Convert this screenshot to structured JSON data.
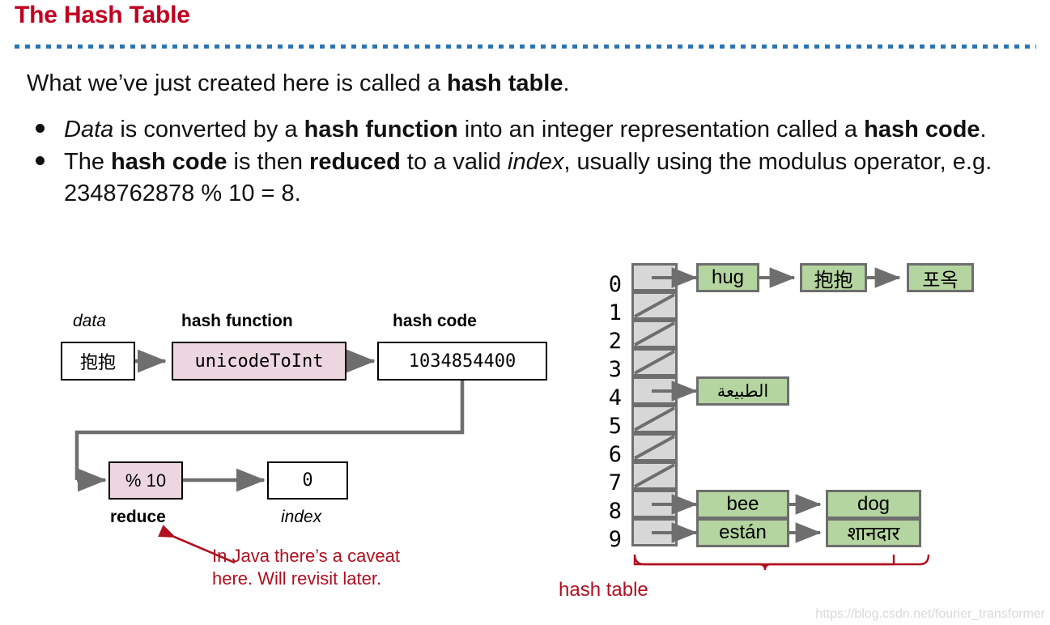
{
  "slide": {
    "title": "The Hash Table",
    "accent_color": "#c00020",
    "rule_color": "#2a74b5",
    "intro_prefix": "What we’ve just created here is called a ",
    "intro_bold": "hash table",
    "intro_suffix": ".",
    "bullets": [
      {
        "parts": [
          {
            "text": "Data",
            "style": "italic"
          },
          {
            "text": " is converted by a ",
            "style": "normal"
          },
          {
            "text": "hash function",
            "style": "bold"
          },
          {
            "text": " into an integer representation called a ",
            "style": "normal"
          },
          {
            "text": "hash code",
            "style": "bold"
          },
          {
            "text": ".",
            "style": "normal"
          }
        ]
      },
      {
        "parts": [
          {
            "text": "The ",
            "style": "normal"
          },
          {
            "text": "hash code",
            "style": "bold"
          },
          {
            "text": " is then ",
            "style": "normal"
          },
          {
            "text": "reduced",
            "style": "bold"
          },
          {
            "text": " to a valid ",
            "style": "normal"
          },
          {
            "text": "index",
            "style": "italic"
          },
          {
            "text": ", usually using the modulus operator, e.g. 2348762878 % 10 = 8.",
            "style": "normal"
          }
        ]
      }
    ]
  },
  "flow": {
    "labels": {
      "data": "data",
      "hash_function": "hash function",
      "hash_code": "hash code",
      "reduce": "reduce",
      "index": "index"
    },
    "boxes": {
      "data_value": "抱抱",
      "function_value": "unicodeToInt",
      "hashcode_value": "1034854400",
      "modulus_value": "% 10",
      "index_value": "0"
    },
    "pink_color": "#ecd6df",
    "arrow_color": "#6e6e6e"
  },
  "annotation": {
    "text": "In Java there’s a caveat\nhere. Will revisit later.",
    "color": "#b01020"
  },
  "hash_table": {
    "label": "hash table",
    "label_color": "#b01020",
    "slot_fill": "#d7d7d7",
    "slot_border": "#6e6e6e",
    "node_fill": "#b4d4a0",
    "node_border": "#6e6e6e",
    "indices": [
      "0",
      "1",
      "2",
      "3",
      "4",
      "5",
      "6",
      "7",
      "8",
      "9"
    ],
    "buckets": [
      {
        "index": "0",
        "empty": false,
        "chain": [
          "hug",
          "抱抱",
          "포옥"
        ]
      },
      {
        "index": "1",
        "empty": true,
        "chain": []
      },
      {
        "index": "2",
        "empty": true,
        "chain": []
      },
      {
        "index": "3",
        "empty": true,
        "chain": []
      },
      {
        "index": "4",
        "empty": false,
        "chain": [
          "الطبيعة"
        ]
      },
      {
        "index": "5",
        "empty": true,
        "chain": []
      },
      {
        "index": "6",
        "empty": true,
        "chain": []
      },
      {
        "index": "7",
        "empty": true,
        "chain": []
      },
      {
        "index": "8",
        "empty": false,
        "chain": [
          "bee",
          "dog"
        ]
      },
      {
        "index": "9",
        "empty": false,
        "chain": [
          "están",
          "शानदार"
        ]
      }
    ]
  },
  "watermark": {
    "text": "https://blog.csdn.net/fourier_transformer"
  }
}
